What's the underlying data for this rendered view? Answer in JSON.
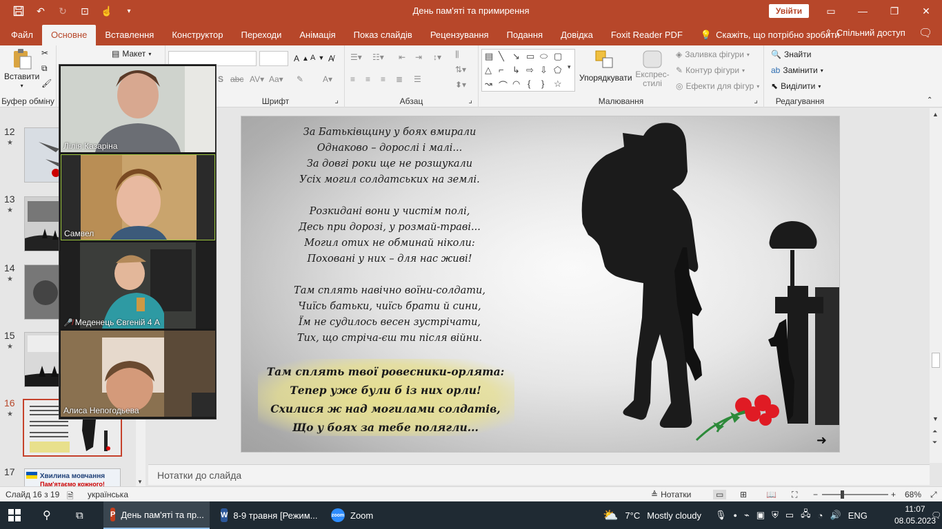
{
  "window": {
    "title": "День пам'яті та примирення",
    "signin_label": "Увійти",
    "qat_icons": [
      "save-icon",
      "undo-icon",
      "redo-icon",
      "start-from-beginning-icon",
      "touch-mode-icon",
      "customize-icon"
    ]
  },
  "menu": {
    "tabs": [
      "Файл",
      "Основне",
      "Вставлення",
      "Конструктор",
      "Переходи",
      "Анімація",
      "Показ слайдів",
      "Рецензування",
      "Подання",
      "Довідка",
      "Foxit Reader PDF"
    ],
    "active_tab": "Основне",
    "tell_me": "Скажіть, що потрібно зробити",
    "share": "Спільний доступ"
  },
  "ribbon": {
    "clipboard": {
      "paste": "Вставити",
      "label": "Буфер обміну"
    },
    "slides": {
      "layout": "Макет"
    },
    "font": {
      "label": "Шрифт"
    },
    "paragraph": {
      "label": "Абзац"
    },
    "drawing": {
      "arrange": "Упорядкувати",
      "quick_styles": "Експрес-стилі",
      "fill": "Заливка фігури",
      "outline": "Контур фігури",
      "effects": "Ефекти для фігур",
      "label": "Малювання"
    },
    "editing": {
      "find": "Знайти",
      "replace": "Замінити",
      "select": "Виділити",
      "label": "Редагування"
    }
  },
  "thumbnails": [
    {
      "num": "12"
    },
    {
      "num": "13"
    },
    {
      "num": "14"
    },
    {
      "num": "15"
    },
    {
      "num": "16"
    },
    {
      "num": "17",
      "title": "Хвилина мовчання",
      "subtitle": "Пам'ятаємо кожного!"
    }
  ],
  "zoom": {
    "participants": [
      {
        "name": "Лілія Казаріна",
        "muted": false
      },
      {
        "name": "Самвел",
        "muted": false
      },
      {
        "name": "Меденець Євгеній 4 А",
        "muted": true
      },
      {
        "name": "Алиса Непогодьева",
        "muted": false
      }
    ]
  },
  "slide": {
    "stanza1": [
      "За Батьківщину у боях вмирали",
      "Однаково – дорослі і малі...",
      "За довгі роки ще не розшукали",
      "Усіх могил солдатських на землі."
    ],
    "stanza2": [
      "Розкидані вони у чистім полі,",
      "Десь при дорозі, у розмай-траві...",
      "Могил отих не обминай ніколи:",
      "Поховані у них – для нас живі!"
    ],
    "stanza3": [
      "Там сплять навічно воїни-солдати,",
      "Чиїсь батьки, чиїсь брати й сини,",
      "Їм не судилось весен зустрічати,",
      "Тих, що стріча-єш ти після війни."
    ],
    "stanza4": [
      "Там сплять твої ровесники-орлята:",
      "Тепер уже були б із них орли!",
      "Схилися ж над могилами солдатів,",
      "Що у боях за тебе полягли..."
    ]
  },
  "notes_placeholder": "Нотатки до слайда",
  "status": {
    "slide_counter": "Слайд 16 з 19",
    "language": "українська",
    "notes_label": "Нотатки",
    "zoom_level": "68%"
  },
  "taskbar": {
    "apps": [
      {
        "label": "День пам'яті та пр...",
        "active": true
      },
      {
        "label": "8-9 травня [Режим...",
        "active": false
      },
      {
        "label": "Zoom",
        "active": false
      }
    ],
    "weather_temp": "7°C",
    "weather_desc": "Mostly cloudy",
    "lang": "ENG",
    "time": "11:07",
    "date": "08.05.2023"
  },
  "colors": {
    "accent": "#b7472a",
    "taskbar": "#1f2a33",
    "highlight": "#e8e08c"
  }
}
